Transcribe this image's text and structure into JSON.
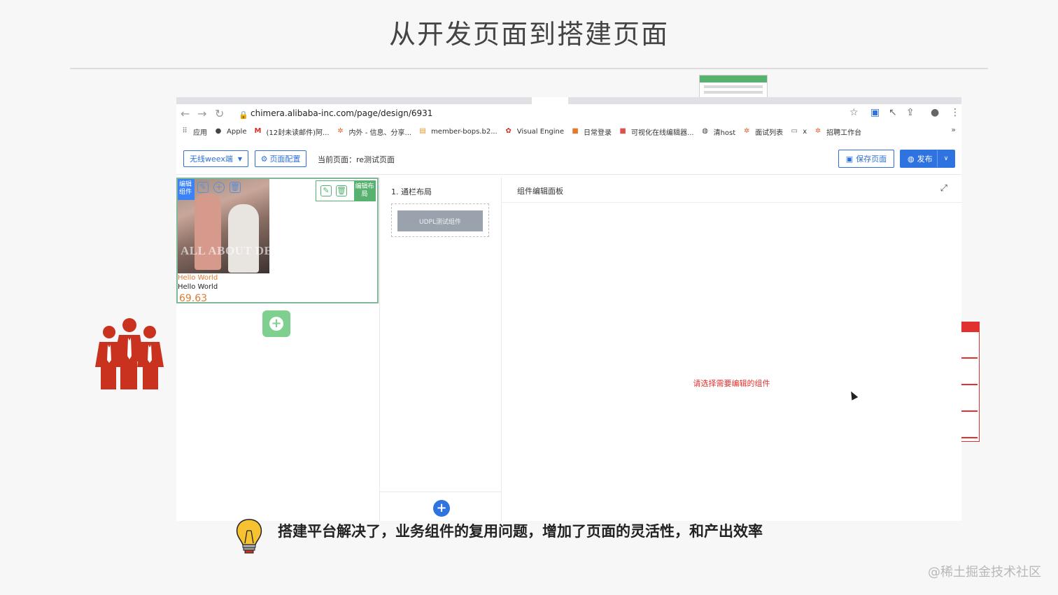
{
  "slide": {
    "title": "从开发页面到搭建页面",
    "bottom_note": "搭建平台解决了，业务组件的复用问题，增加了页面的灵活性，和产出效率",
    "watermark": "@稀土掘金技术社区"
  },
  "browser": {
    "url": "chimera.alibaba-inc.com/page/design/6931",
    "nav_icons": [
      "back-icon",
      "forward-icon",
      "reload-icon"
    ],
    "bookmarks": [
      {
        "label": "应用",
        "icon": "apps-grid-icon"
      },
      {
        "label": "Apple",
        "icon": "apple-icon"
      },
      {
        "label": "(12封未读邮件)阿...",
        "icon": "gmail-icon"
      },
      {
        "label": "内外 - 信息、分享...",
        "icon": "star-burst-icon"
      },
      {
        "label": "member-bops.b2...",
        "icon": "page-icon"
      },
      {
        "label": "Visual Engine",
        "icon": "engine-icon"
      },
      {
        "label": "日常登录",
        "icon": "orange-square-icon"
      },
      {
        "label": "可视化在线编辑器...",
        "icon": "red-square-icon"
      },
      {
        "label": "清host",
        "icon": "globe-icon"
      },
      {
        "label": "面试列表",
        "icon": "star-burst-icon"
      },
      {
        "label": "x",
        "icon": "folder-icon"
      },
      {
        "label": "招聘工作台",
        "icon": "star-burst-icon"
      }
    ],
    "more": "»"
  },
  "toolbar": {
    "platform_select": "无线weex端",
    "page_config": "页面配置",
    "current_page_label": "当前页面：",
    "current_page_value": "re测试页面",
    "save_page": "保存页面",
    "publish": "发布"
  },
  "canvas": {
    "edit_component_tag": "编辑组件",
    "edit_layout_tag": "编辑布局",
    "photo_caption": "ALL ABOUT DENIM",
    "text_1": "Hello World",
    "text_2": "Hello World",
    "price": "69.63"
  },
  "layout_panel": {
    "title": "1. 通栏布局",
    "component_button": "UDPL测试组件"
  },
  "editor_panel": {
    "title": "组件编辑面板",
    "hint": "请选择需要编辑的组件"
  },
  "colors": {
    "primary": "#2f73e0",
    "layout_green": "#58b26f",
    "add_green": "#7fcf8f",
    "accent_orange": "#e07b2f",
    "hint_red": "#e0312e",
    "people_red": "#c8321f"
  }
}
